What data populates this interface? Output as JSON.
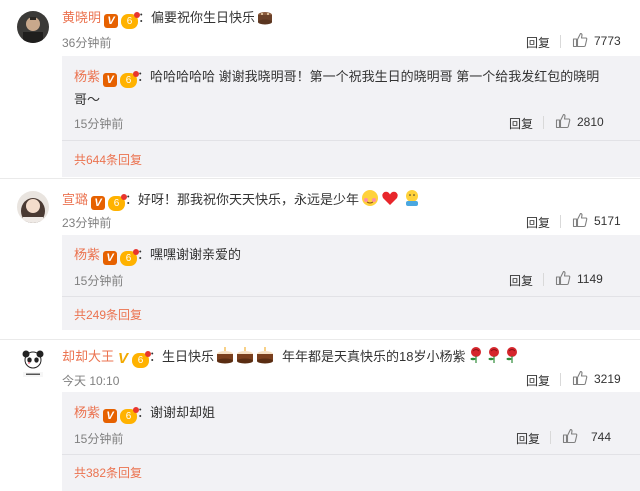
{
  "comments": [
    {
      "user": "黄晓明",
      "text": "偏要祝你生日快乐",
      "time": "36分钟前",
      "reply_label": "回复",
      "likes": "7773",
      "replies": [
        {
          "user": "杨紫",
          "text": "哈哈哈哈哈 谢谢我晓明哥！第一个祝我生日的晓明哥 第一个给我发红包的晓明",
          "text2": "哥～",
          "time": "15分钟前",
          "reply_label": "回复",
          "likes": "2810"
        }
      ],
      "more": "共644条回复"
    },
    {
      "user": "宣璐",
      "text": "好呀！那我祝你天天快乐，永远是少年",
      "time": "23分钟前",
      "reply_label": "回复",
      "likes": "5171",
      "replies": [
        {
          "user": "杨紫",
          "text": "嘿嘿谢谢亲爱的",
          "time": "15分钟前",
          "reply_label": "回复",
          "likes": "1149"
        }
      ],
      "more": "共249条回复"
    },
    {
      "user": "却却大王",
      "text": "生日快乐",
      "text_b": "年年都是天真快乐的18岁小杨紫",
      "time": "今天 10:10",
      "reply_label": "回复",
      "likes": "3219",
      "replies": [
        {
          "user": "杨紫",
          "text": "谢谢却却姐",
          "time": "15分钟前",
          "reply_label": "回复",
          "likes": "744"
        }
      ],
      "more": "共382条回复"
    }
  ],
  "badges": {
    "verified": "V",
    "level": "6"
  },
  "colon": "：",
  "icons": {
    "cake": "cake-icon",
    "like": "thumbs-up-icon",
    "blush": "blush-emoji-icon",
    "heart": "red-heart-icon",
    "hug": "hug-emoji-icon",
    "rose": "rose-icon"
  },
  "colors": {
    "username": "#eb7350",
    "reply_bg": "#f2f2f5",
    "verified": "#e66100"
  }
}
